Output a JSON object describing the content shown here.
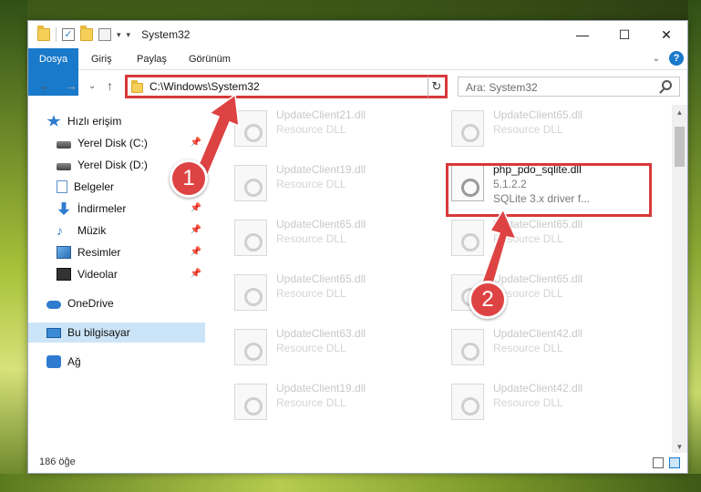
{
  "window": {
    "title": "System32",
    "minimize_icon": "minimize-icon",
    "maximize_icon": "maximize-icon",
    "close_icon": "close-icon"
  },
  "ribbon": {
    "tabs": [
      {
        "label": "Dosya"
      },
      {
        "label": "Giriş"
      },
      {
        "label": "Paylaş"
      },
      {
        "label": "Görünüm"
      }
    ],
    "help": "?"
  },
  "nav": {
    "address": "C:\\Windows\\System32",
    "search_placeholder": "Ara: System32"
  },
  "sidebar": {
    "items": [
      {
        "label": "Hızlı erişim",
        "icon": "star-icon"
      },
      {
        "label": "Yerel Disk (C:)",
        "icon": "disk-icon"
      },
      {
        "label": "Yerel Disk (D:)",
        "icon": "disk-icon"
      },
      {
        "label": "Belgeler",
        "icon": "documents-icon"
      },
      {
        "label": "İndirmeler",
        "icon": "download-icon"
      },
      {
        "label": "Müzik",
        "icon": "music-icon"
      },
      {
        "label": "Resimler",
        "icon": "pictures-icon"
      },
      {
        "label": "Videolar",
        "icon": "videos-icon"
      },
      {
        "label": "OneDrive",
        "icon": "cloud-icon"
      },
      {
        "label": "Bu bilgisayar",
        "icon": "computer-icon"
      },
      {
        "label": "Ağ",
        "icon": "network-icon"
      }
    ]
  },
  "files": {
    "left": [
      {
        "name": "UpdateClient21.dll",
        "sub": "Resource DLL"
      },
      {
        "name": "UpdateClient19.dll",
        "sub": "Resource DLL"
      },
      {
        "name": "UpdateClient65.dll",
        "sub": "Resource DLL"
      },
      {
        "name": "UpdateClient65.dll",
        "sub": "Resource DLL"
      },
      {
        "name": "UpdateClient63.dll",
        "sub": "Resource DLL"
      },
      {
        "name": "UpdateClient19.dll",
        "sub": "Resource DLL"
      }
    ],
    "right": [
      {
        "name": "UpdateClient65.dll",
        "sub": "Resource DLL"
      },
      {
        "name": "php_pdo_sqlite.dll",
        "sub": "5.1.2.2",
        "sub2": "SQLite 3.x driver f..."
      },
      {
        "name": "UpdateClient65.dll",
        "sub": "Resource DLL"
      },
      {
        "name": "UpdateClient65.dll",
        "sub": "Resource DLL"
      },
      {
        "name": "UpdateClient42.dll",
        "sub": "Resource DLL"
      },
      {
        "name": "UpdateClient42.dll",
        "sub": "Resource DLL"
      }
    ]
  },
  "status": {
    "count": "186 öğe"
  },
  "annotations": {
    "step1": "1",
    "step2": "2",
    "accent_color": "#de4343"
  }
}
